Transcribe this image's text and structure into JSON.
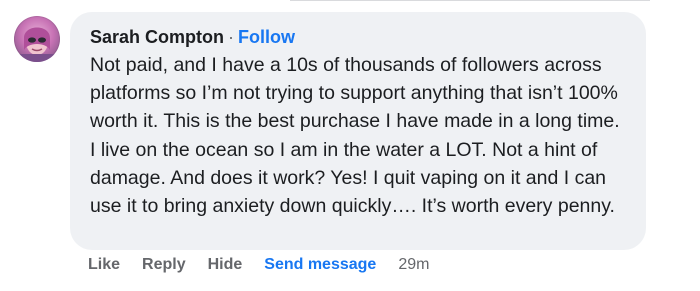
{
  "comment": {
    "author": "Sarah Compton",
    "separator": "·",
    "follow_label": "Follow",
    "text": "Not paid, and I have a 10s of thousands of followers across platforms so I’m not trying to support anything that isn’t 100% worth it. This is the best purchase I have made in a long time. I live on the ocean so I am in the water a LOT. Not a hint of damage. And does it work? Yes! I quit vaping on it and I can use it to bring anxiety down quickly…. It’s worth every penny."
  },
  "actions": {
    "like_label": "Like",
    "reply_label": "Reply",
    "hide_label": "Hide",
    "send_message_label": "Send message",
    "timestamp": "29m"
  },
  "colors": {
    "bubble_bg": "#eff1f4",
    "link_blue": "#1877f2",
    "secondary_text": "#65676b",
    "primary_text": "#1c1e21"
  }
}
